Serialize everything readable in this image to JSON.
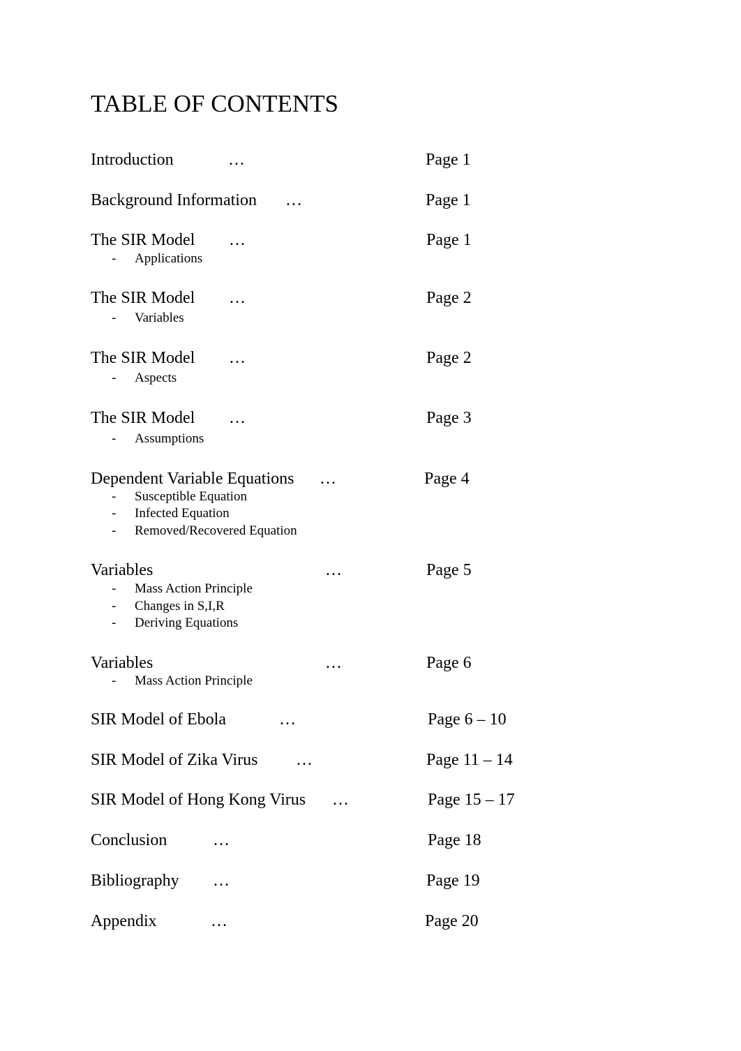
{
  "document": {
    "title": "TABLE OF CONTENTS",
    "leader": "…",
    "sub_marker": "-",
    "entries": [
      {
        "label": "Introduction",
        "page": "Page 1",
        "subitems": []
      },
      {
        "label": "Background Information",
        "page": "Page 1",
        "subitems": []
      },
      {
        "label": "The SIR Model",
        "page": "Page 1",
        "subitems": [
          "Applications"
        ]
      },
      {
        "label": "The SIR Model",
        "page": "Page 2",
        "subitems": [
          "Variables"
        ]
      },
      {
        "label": "The SIR Model",
        "page": "Page 2",
        "subitems": [
          "Aspects"
        ]
      },
      {
        "label": "The SIR Model",
        "page": "Page 3",
        "subitems": [
          "Assumptions"
        ]
      },
      {
        "label": "Dependent Variable Equations",
        "page": "Page 4",
        "subitems": [
          "Susceptible Equation",
          "Infected Equation",
          "Removed/Recovered Equation"
        ]
      },
      {
        "label": "Variables",
        "page": "Page 5",
        "subitems": [
          "Mass Action Principle",
          "Changes in S,I,R",
          "Deriving Equations"
        ]
      },
      {
        "label": "Variables",
        "page": "Page 6",
        "subitems": [
          "Mass Action Principle"
        ]
      },
      {
        "label": "SIR Model of Ebola",
        "page": "Page 6 – 10",
        "subitems": []
      },
      {
        "label": "SIR Model of Zika Virus",
        "page": "Page 11 – 14",
        "subitems": []
      },
      {
        "label": "SIR Model of Hong Kong Virus",
        "page": "Page 15 – 17",
        "subitems": []
      },
      {
        "label": "Conclusion",
        "page": "Page 18",
        "subitems": []
      },
      {
        "label": "Bibliography",
        "page": "Page 19",
        "subitems": []
      },
      {
        "label": "Appendix",
        "page": "Page 20",
        "subitems": []
      }
    ]
  }
}
